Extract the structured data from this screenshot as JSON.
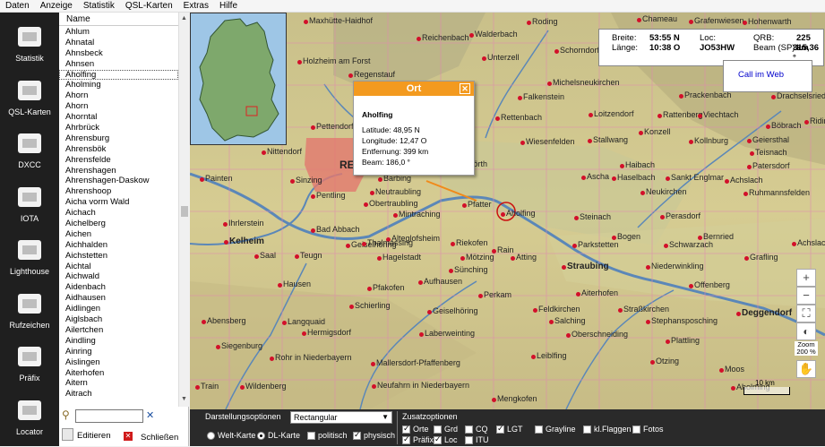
{
  "menu": [
    "Daten",
    "Anzeige",
    "Statistik",
    "QSL-Karten",
    "Extras",
    "Hilfe"
  ],
  "nav": [
    "Statistik",
    "QSL-Karten",
    "DXCC",
    "IOTA",
    "Lighthouse",
    "Rufzeichen",
    "Präfix",
    "Locator"
  ],
  "list": {
    "header": "Name",
    "items": [
      "Ahlum",
      "Ahnatal",
      "Ahnsbeck",
      "Ahnsen",
      "Aholfing",
      "Aholming",
      "Ahorn",
      "Ahorn",
      "Ahorntal",
      "Ahrbrück",
      "Ahrensburg",
      "Ahrensbök",
      "Ahrensfelde",
      "Ahrenshagen",
      "Ahrenshagen-Daskow",
      "Ahrenshoop",
      "Aicha vorm Wald",
      "Aichach",
      "Aichelberg",
      "Aichen",
      "Aichhalden",
      "Aichstetten",
      "Aichtal",
      "Aichwald",
      "Aidenbach",
      "Aidhausen",
      "Aidlingen",
      "Aiglsbach",
      "Ailertchen",
      "Aindling",
      "Ainring",
      "Aislingen",
      "Aiterhofen",
      "Aitern",
      "Aitrach"
    ],
    "selected": "Aholfing",
    "search_value": "",
    "edit_label": "Editieren",
    "close_label": "Schließen"
  },
  "info": {
    "breite_label": "Breite:",
    "breite": "53:55 N",
    "laenge_label": "Länge:",
    "laenge": "10:38 O",
    "loc_label": "Loc:",
    "loc": "JO53HW",
    "qrb_label": "QRB:",
    "qrb": "225 km",
    "beam_label": "Beam (SP):",
    "beam": "315,36 °"
  },
  "call_link": "Call im Web",
  "popup": {
    "title": "Ort",
    "name": "Aholfing",
    "lat": "Latitude: 48,95 N",
    "lon": "Longitude: 12,47 O",
    "dist": "Entfernung: 399 km",
    "beam": "Beam: 186,0 °"
  },
  "zoom_label": "Zoom 200 %",
  "scale_label": "10 km",
  "map_places": [
    [
      "Maxhütte-Haidhof",
      133,
      4
    ],
    [
      "Reichenbach",
      259,
      23
    ],
    [
      "Walderbach",
      318,
      19
    ],
    [
      "Roding",
      382,
      5
    ],
    [
      "Chameau",
      505,
      2
    ],
    [
      "Grafenwiesen",
      563,
      4
    ],
    [
      "Hohenwarth",
      623,
      5
    ],
    [
      "Holzheim am Forst",
      126,
      49
    ],
    [
      "Unterzell",
      332,
      45
    ],
    [
      "Schorndorf",
      413,
      37
    ],
    [
      "Zandt",
      492,
      51
    ],
    [
      "Regenstauf",
      183,
      64
    ],
    [
      "Michelsneukirchen",
      405,
      73
    ],
    [
      "Falkenstein",
      372,
      89
    ],
    [
      "Prackenbach",
      552,
      87
    ],
    [
      "Drachselsried",
      655,
      88
    ],
    [
      "Pettendorf",
      141,
      122
    ],
    [
      "Rettenbach",
      347,
      112
    ],
    [
      "Loitzendorf",
      451,
      108
    ],
    [
      "Rattenberg",
      528,
      109
    ],
    [
      "Viechtach",
      573,
      109
    ],
    [
      "Böbrach",
      649,
      121
    ],
    [
      "Ridin",
      692,
      116
    ],
    [
      "Nittendorf",
      86,
      150
    ],
    [
      "Wiesenfelden",
      375,
      139
    ],
    [
      "Stallwang",
      450,
      137
    ],
    [
      "Konzell",
      507,
      128
    ],
    [
      "Kollnburg",
      563,
      138
    ],
    [
      "Geiersthal",
      628,
      137
    ],
    [
      "Teisnach",
      631,
      151
    ],
    [
      "Haibach",
      486,
      165
    ],
    [
      "Patersdorf",
      628,
      166
    ],
    [
      "Painten",
      17,
      180
    ],
    [
      "Sinzing",
      118,
      182
    ],
    [
      "Barbing",
      216,
      180
    ],
    [
      "Wörth",
      308,
      164
    ],
    [
      "Ascha",
      443,
      178
    ],
    [
      "Haselbach",
      477,
      179
    ],
    [
      "Sankt Englmar",
      537,
      179
    ],
    [
      "Achslach",
      603,
      182
    ],
    [
      "Pentling",
      141,
      199
    ],
    [
      "Neutraubling",
      207,
      195
    ],
    [
      "Neukirchen",
      509,
      195
    ],
    [
      "Ruhmannsfelden",
      624,
      196
    ],
    [
      "Obertraubling",
      200,
      208
    ],
    [
      "Pfatter",
      310,
      209
    ],
    [
      "Mintraching",
      233,
      220
    ],
    [
      "Aholfing",
      353,
      219
    ],
    [
      "Steinach",
      435,
      223
    ],
    [
      "Perasdorf",
      531,
      222
    ],
    [
      "Ihrlerstein",
      43,
      230
    ],
    [
      "Bad Abbach",
      141,
      237
    ],
    [
      "Geiselhöring",
      180,
      254
    ],
    [
      "Alteglofsheim",
      225,
      247
    ],
    [
      "Bogen",
      477,
      245
    ],
    [
      "Bernried",
      573,
      245
    ],
    [
      "Kelheim",
      44,
      250
    ],
    [
      "Thalmassing",
      198,
      252
    ],
    [
      "Riekofen",
      297,
      252
    ],
    [
      "Parkstetten",
      433,
      254
    ],
    [
      "Schwarzach",
      535,
      254
    ],
    [
      "Achslach",
      678,
      252
    ],
    [
      "Saal",
      78,
      266
    ],
    [
      "Teugn",
      123,
      266
    ],
    [
      "Hagelstadt",
      215,
      268
    ],
    [
      "Rain",
      343,
      260
    ],
    [
      "Mötzing",
      308,
      268
    ],
    [
      "Atting",
      364,
      268
    ],
    [
      "Straubing",
      421,
      278
    ],
    [
      "Niederwinkling",
      515,
      278
    ],
    [
      "Grafling",
      625,
      268
    ],
    [
      "Hausen",
      104,
      298
    ],
    [
      "Sünching",
      295,
      282
    ],
    [
      "Pfakofen",
      204,
      302
    ],
    [
      "Aufhausen",
      261,
      295
    ],
    [
      "Offenberg",
      563,
      299
    ],
    [
      "Aiterhofen",
      437,
      308
    ],
    [
      "Perkam",
      328,
      310
    ],
    [
      "Schierling",
      184,
      322
    ],
    [
      "Geiselhöring",
      271,
      328
    ],
    [
      "Feldkirchen",
      389,
      326
    ],
    [
      "Straßkirchen",
      484,
      326
    ],
    [
      "Deggendorf",
      616,
      330
    ],
    [
      "Langquaid",
      109,
      340
    ],
    [
      "Salching",
      407,
      339
    ],
    [
      "Stephansposching",
      515,
      339
    ],
    [
      "Abensberg",
      19,
      339
    ],
    [
      "Hermigsdorf",
      131,
      352
    ],
    [
      "Laberweinting",
      262,
      353
    ],
    [
      "Oberschneiding",
      426,
      354
    ],
    [
      "Plattling",
      537,
      361
    ],
    [
      "Rohr in Niederbayern",
      95,
      380
    ],
    [
      "Mallersdorf-Pfaffenberg",
      208,
      386
    ],
    [
      "Leiblfing",
      387,
      378
    ],
    [
      "Moos",
      597,
      393
    ],
    [
      "Siegenburg",
      35,
      367
    ],
    [
      "Wildenberg",
      62,
      412
    ],
    [
      "Neufahrn in Niederbayern",
      209,
      411
    ],
    [
      "Otzing",
      520,
      384
    ],
    [
      "Train",
      12,
      412
    ],
    [
      "Mengkofen",
      343,
      426
    ],
    [
      "Aholming",
      610,
      413
    ]
  ],
  "bottom": {
    "display_title": "Darstellungsoptionen",
    "projection": "Rectangular",
    "radio_world": "Welt-Karte",
    "radio_dl": "DL-Karte",
    "cb_politisch": "politisch",
    "cb_physisch": "physisch",
    "extra_title": "Zusatzoptionen",
    "extras": [
      [
        "Orte",
        true
      ],
      [
        "Grd",
        false
      ],
      [
        "CQ",
        false
      ],
      [
        "LGT",
        true
      ],
      [
        "Grayline",
        false
      ],
      [
        "kl.Flaggen",
        false
      ],
      [
        "Fotos",
        false
      ],
      [
        "Präfix",
        true
      ],
      [
        "Loc",
        true
      ],
      [
        "ITU",
        false
      ]
    ]
  }
}
